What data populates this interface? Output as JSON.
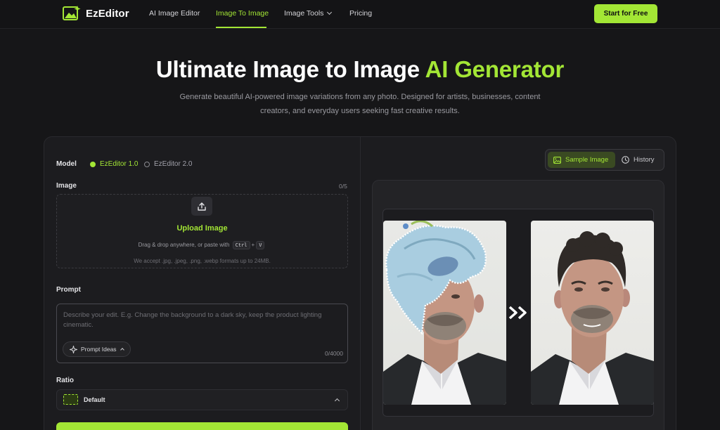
{
  "nav": {
    "brand": "EzEditor",
    "items": [
      "AI Image Editor",
      "Image To Image",
      "Image Tools",
      "Pricing"
    ],
    "active": "Image To Image",
    "cta": "Start for Free"
  },
  "hero": {
    "title_main": "Ultimate Image to Image ",
    "title_accent": "AI Generator",
    "subtitle": "Generate beautiful AI-powered image variations from any photo. Designed for artists, businesses, content creators, and everyday users seeking fast creative results."
  },
  "form": {
    "model_label": "Model",
    "models": [
      "EzEditor 1.0",
      "EzEditor 2.0"
    ],
    "selected_model": "EzEditor 1.0",
    "image_label": "Image",
    "image_count": "0/5",
    "upload_title": "Upload Image",
    "upload_hint_prefix": "Drag & drop anywhere, or paste with",
    "key_ctrl": "Ctrl",
    "key_plus": "+",
    "key_v": "V",
    "upload_accept": "We accept .jpg, .jpeg, .png, .webp formats up to 24MB.",
    "prompt_label": "Prompt",
    "prompt_placeholder": "Describe your edit. E.g. Change the background to a dark sky, keep the product lighting cinematic.",
    "prompt_ideas": "Prompt Ideas",
    "prompt_count": "0/4000",
    "ratio_label": "Ratio",
    "ratio_value": "Default"
  },
  "preview": {
    "tabs": [
      "Sample Image",
      "History"
    ],
    "active_tab": "Sample Image"
  },
  "colors": {
    "accent": "#a3e635",
    "background": "#161618",
    "panel": "#1c1c1f"
  },
  "icons": {
    "logo": "image-sparkle-icon",
    "upload": "upload-icon",
    "prompt_ideas": "sparkle-icon",
    "sample_image": "image-icon",
    "history": "clock-icon",
    "ratio": "dashed-rect-icon",
    "transform": "double-chevron-right-icon"
  }
}
